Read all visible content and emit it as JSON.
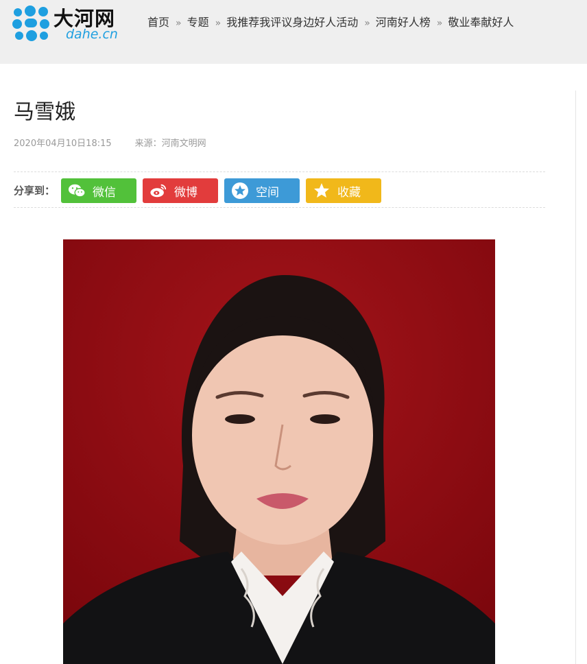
{
  "header": {
    "logo_text": "大河网",
    "logo_domain": "dahe.cn",
    "breadcrumb": [
      {
        "label": "首页"
      },
      {
        "label": "专题"
      },
      {
        "label": "我推荐我评议身边好人活动"
      },
      {
        "label": "河南好人榜"
      },
      {
        "label": "敬业奉献好人"
      }
    ],
    "separator": "»"
  },
  "article": {
    "title": "马雪娥",
    "date": "2020年04月10日18:15",
    "source": "来源：河南文明网"
  },
  "share": {
    "label": "分享到：",
    "buttons": [
      {
        "label": "微信",
        "icon": "wechat-icon",
        "color": "#52c13a"
      },
      {
        "label": "微博",
        "icon": "weibo-icon",
        "color": "#e23c3c"
      },
      {
        "label": "空间",
        "icon": "qzone-icon",
        "color": "#3d9ad7"
      },
      {
        "label": "收藏",
        "icon": "star-icon",
        "color": "#f1b81a"
      }
    ]
  },
  "photo": {
    "background_color": "#8e0a10"
  }
}
